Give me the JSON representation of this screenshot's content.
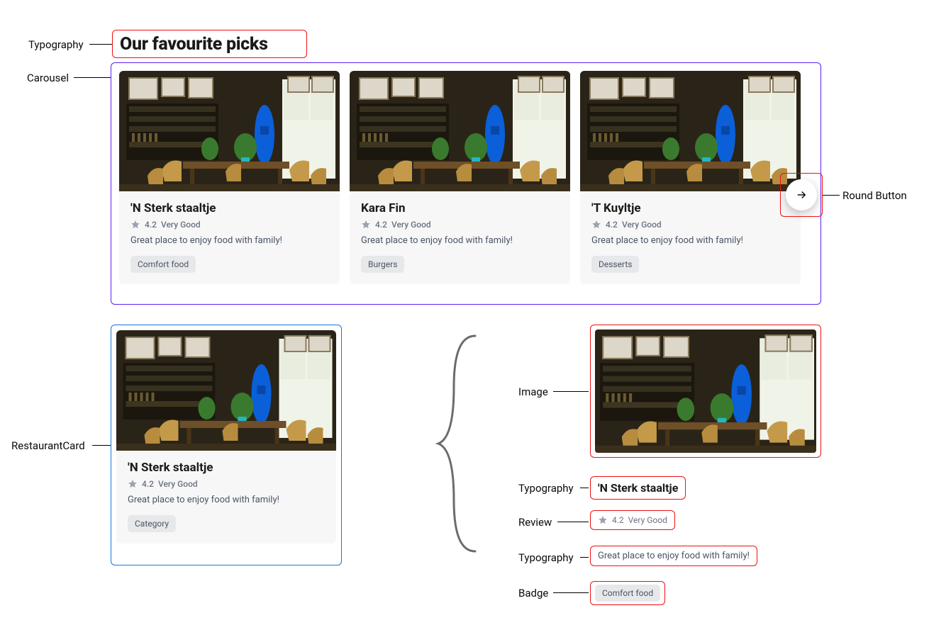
{
  "annotations": {
    "typography_heading": "Typography",
    "carousel": "Carousel",
    "round_button": "Round Button",
    "restaurant_card": "RestaurantCard",
    "image": "Image",
    "typography_title": "Typography",
    "review": "Review",
    "typography_desc": "Typography",
    "badge": "Badge"
  },
  "heading": "Our favourite picks",
  "carousel_cards": [
    {
      "title": "'N Sterk staaltje",
      "rating": "4.2",
      "rating_label": "Very Good",
      "description": "Great place to enjoy food with family!",
      "tag": "Comfort food"
    },
    {
      "title": "Kara Fin",
      "rating": "4.2",
      "rating_label": "Very Good",
      "description": "Great place to enjoy food with family!",
      "tag": "Burgers"
    },
    {
      "title": "'T Kuyltje",
      "rating": "4.2",
      "rating_label": "Very Good",
      "description": "Great place to enjoy food with family!",
      "tag": "Desserts"
    }
  ],
  "standalone_card": {
    "title": "'N Sterk staaltje",
    "rating": "4.2",
    "rating_label": "Very Good",
    "description": "Great place to enjoy food with family!",
    "tag": "Category"
  },
  "breakdown": {
    "title": "'N Sterk staaltje",
    "rating": "4.2",
    "rating_label": "Very Good",
    "description": "Great place to enjoy food with family!",
    "tag": "Comfort food"
  }
}
